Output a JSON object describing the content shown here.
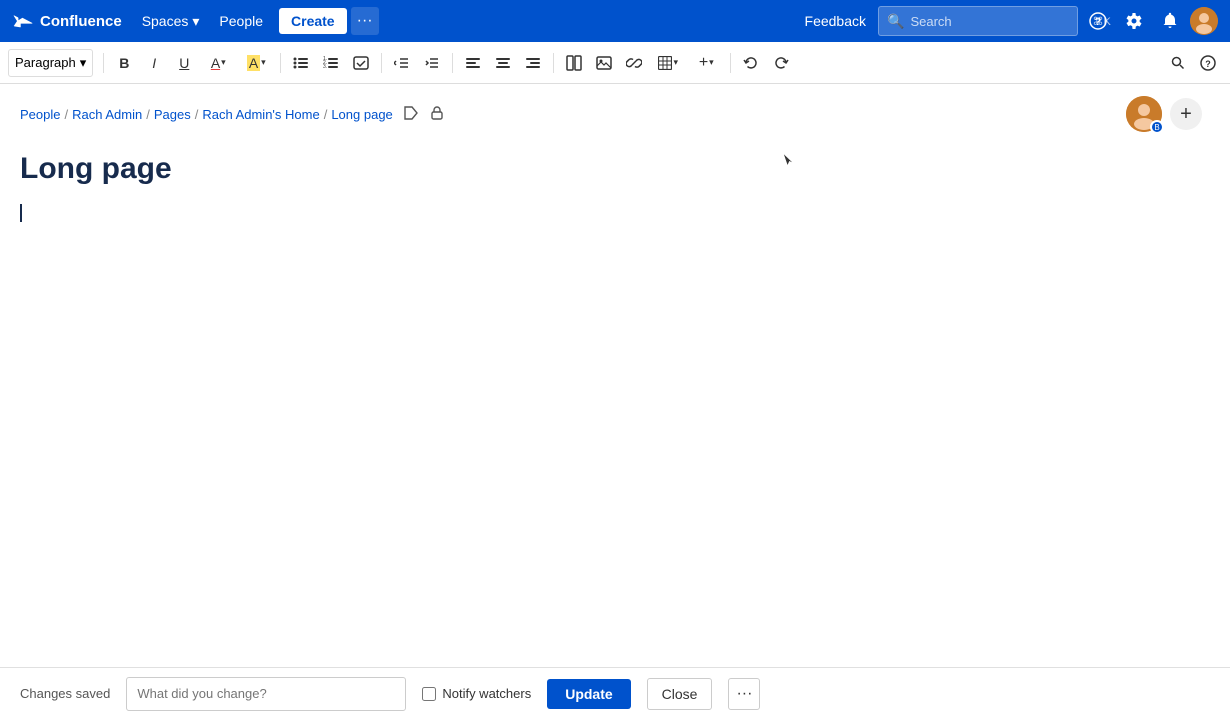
{
  "app": {
    "name": "Confluence",
    "logo_text": "Confluence"
  },
  "nav": {
    "spaces_label": "Spaces",
    "people_label": "People",
    "create_label": "Create",
    "more_label": "···",
    "feedback_label": "Feedback",
    "search_placeholder": "Search",
    "help_icon": "?",
    "settings_icon": "⚙",
    "notifications_icon": "🔔"
  },
  "toolbar": {
    "paragraph_label": "Paragraph",
    "bold_label": "B",
    "italic_label": "I",
    "underline_label": "U",
    "text_color_label": "A",
    "highlight_label": "A",
    "bullet_list_label": "≡",
    "numbered_list_label": "≡",
    "task_label": "☑",
    "indent_out_label": "⇤",
    "indent_in_label": "⇥",
    "align_left_label": "≡",
    "align_center_label": "≡",
    "align_right_label": "≡",
    "layout_label": "⊟",
    "image_label": "🖼",
    "link_label": "🔗",
    "table_label": "⊞",
    "insert_label": "+",
    "undo_label": "↩",
    "redo_label": "↪",
    "search_icon_label": "🔍",
    "help_icon_label": "?"
  },
  "breadcrumb": {
    "items": [
      {
        "label": "People",
        "link": true
      },
      {
        "label": "Rach Admin",
        "link": true
      },
      {
        "label": "Pages",
        "link": true
      },
      {
        "label": "Rach Admin's Home",
        "link": true
      },
      {
        "label": "Long page",
        "link": false
      }
    ],
    "separator": "/"
  },
  "page": {
    "title": "Long page",
    "content": ""
  },
  "bottom_bar": {
    "changes_saved_label": "Changes saved",
    "change_placeholder": "What did you change?",
    "notify_watchers_label": "Notify watchers",
    "update_label": "Update",
    "close_label": "Close",
    "more_label": "···"
  }
}
